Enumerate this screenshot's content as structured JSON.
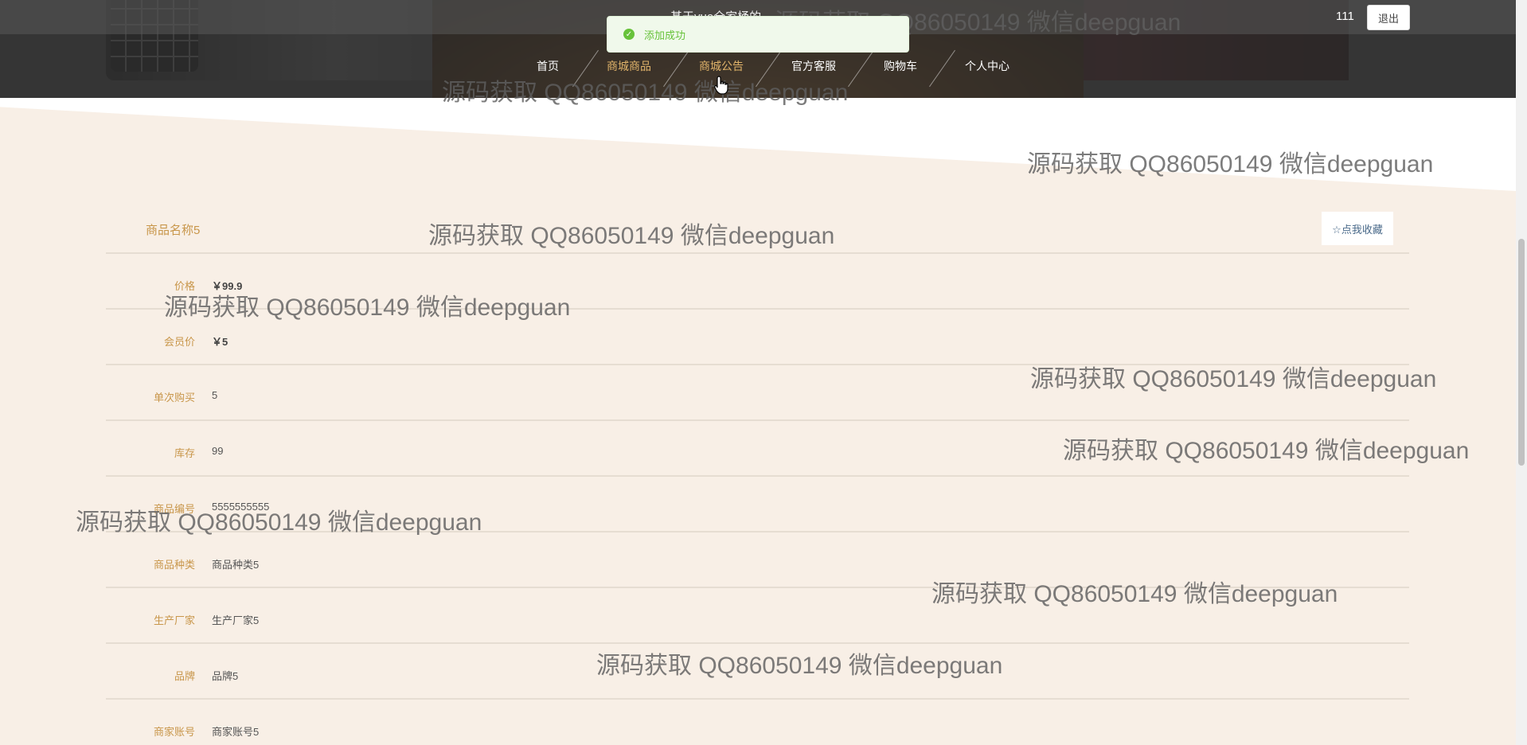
{
  "header": {
    "site_title": "基于vue全家桶的",
    "user_name": "111",
    "logout_label": "退出"
  },
  "nav": {
    "items": [
      {
        "label": "首页"
      },
      {
        "label": "商城商品"
      },
      {
        "label": "商城公告"
      },
      {
        "label": "官方客服"
      },
      {
        "label": "购物车"
      },
      {
        "label": "个人中心"
      }
    ],
    "active_index": 1,
    "hover_index": 2
  },
  "toast": {
    "message": "添加成功",
    "color": "#67c23a"
  },
  "product": {
    "name": "商品名称5",
    "favorite_label": "☆点我收藏",
    "rows": [
      {
        "label": "价格",
        "value": "￥99.9"
      },
      {
        "label": "会员价",
        "value": "￥5"
      },
      {
        "label": "单次购买",
        "value": "5"
      },
      {
        "label": "库存",
        "value": "99"
      },
      {
        "label": "商品编号",
        "value": "5555555555"
      },
      {
        "label": "商品种类",
        "value": "商品种类5"
      },
      {
        "label": "生产厂家",
        "value": "生产厂家5"
      },
      {
        "label": "品牌",
        "value": "品牌5"
      },
      {
        "label": "商家账号",
        "value": "商家账号5"
      }
    ]
  },
  "watermark": {
    "text": "源码获取 QQ86050149 微信deepguan"
  },
  "colors": {
    "accent_gold": "#c8964a",
    "page_bg": "#f8efe6",
    "nav_bg": "#2d2d2d",
    "success": "#67c23a"
  }
}
